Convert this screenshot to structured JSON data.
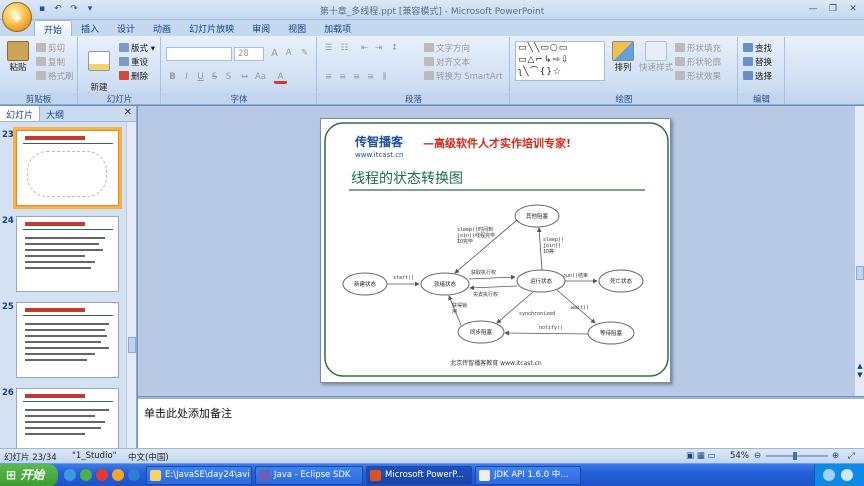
{
  "window": {
    "title": "第十章_多线程.ppt [兼容模式] - Microsoft PowerPoint"
  },
  "tabs": [
    "开始",
    "插入",
    "设计",
    "动画",
    "幻灯片放映",
    "审阅",
    "视图",
    "加载项"
  ],
  "ribbon": {
    "clipboard": {
      "label": "剪贴板",
      "paste": "粘贴",
      "cut": "剪切",
      "copy": "复制",
      "format_painter": "格式刷"
    },
    "slides": {
      "label": "幻灯片",
      "new_slide": "新建\n幻灯片",
      "layout": "版式",
      "reset": "重设",
      "delete": "删除"
    },
    "font": {
      "label": "字体",
      "size": "28"
    },
    "paragraph": {
      "label": "段落",
      "text_direction": "文字方向",
      "align_text": "对齐文本",
      "convert_smartart": "转换为 SmartArt"
    },
    "drawing": {
      "label": "绘图",
      "arrange": "排列",
      "quick_styles": "快速样式",
      "shape_fill": "形状填充",
      "shape_outline": "形状轮廓",
      "shape_effects": "形状效果"
    },
    "editing": {
      "label": "编辑",
      "find": "查找",
      "replace": "替换",
      "select": "选择"
    }
  },
  "left_pane": {
    "tab_slides": "幻灯片",
    "tab_outline": "大纲",
    "thumbs": [
      {
        "num": "23"
      },
      {
        "num": "24"
      },
      {
        "num": "25"
      },
      {
        "num": "26"
      }
    ]
  },
  "slide": {
    "brand": "传智播客",
    "url": "www.itcast.cn",
    "slogan": "—高级软件人才实作培训专家!",
    "title": "线程的状态转换图",
    "footer": "北京传智播客教育 www.itcast.cn",
    "states": {
      "new": "新建状态",
      "ready": "就绪状态",
      "running": "运行状态",
      "dead": "死亡状态",
      "blocked_other": "其他阻塞",
      "blocked_sync": "同步阻塞",
      "blocked_wait": "等待阻塞"
    },
    "labels": {
      "start": "start()",
      "get_cpu": "获取执行权",
      "lose_cpu": "失去执行权",
      "run_end": "run()结束",
      "sleep_done": "sleep()时间到\njoin()线程完毕\nIO完毕",
      "sleep_call": "sleep()\njoin()\nIO等",
      "wait": "wait()",
      "sync": "synchronized",
      "notify": "notify()",
      "lock": "获得锁\n用"
    }
  },
  "notes": {
    "placeholder": "单击此处添加备注"
  },
  "status": {
    "slide_info": "幻灯片 23/34",
    "theme": "\"1_Studio\"",
    "lang": "中文(中国)",
    "zoom": "54%"
  },
  "taskbar": {
    "start": "开始",
    "tasks": [
      "E:\\JavaSE\\day24\\avi",
      "Java - Eclipse SDK",
      "Microsoft PowerP...",
      "JDK API 1.6.0 中..."
    ]
  }
}
